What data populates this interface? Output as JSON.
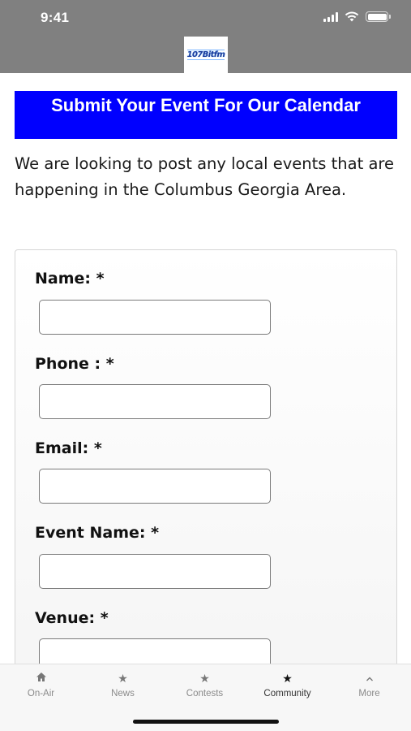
{
  "status_bar": {
    "time": "9:41"
  },
  "header": {
    "logo_text": "107Bitfm",
    "logo_icon": "station-logo"
  },
  "banner": {
    "title": "Submit Your Event For Our Calendar"
  },
  "intro": {
    "text": "We are looking to post any local events that are happening in the Columbus Georgia Area."
  },
  "form": {
    "fields": [
      {
        "label": "Name: *",
        "value": "",
        "placeholder": ""
      },
      {
        "label": "Phone : *",
        "value": "",
        "placeholder": ""
      },
      {
        "label": "Email: *",
        "value": "",
        "placeholder": ""
      },
      {
        "label": "Event Name: *",
        "value": "",
        "placeholder": ""
      },
      {
        "label": "Venue: *",
        "value": "",
        "placeholder": ""
      }
    ]
  },
  "tabbar": {
    "tabs": [
      {
        "label": "On-Air",
        "icon": "home-icon"
      },
      {
        "label": "News",
        "icon": "star-icon"
      },
      {
        "label": "Contests",
        "icon": "star-icon"
      },
      {
        "label": "Community",
        "icon": "star-icon",
        "active": true
      },
      {
        "label": "More",
        "icon": "chevron-up-icon"
      }
    ]
  },
  "colors": {
    "header_bg": "#808080",
    "banner_bg": "#0000ff",
    "text": "#1a1a1a"
  }
}
